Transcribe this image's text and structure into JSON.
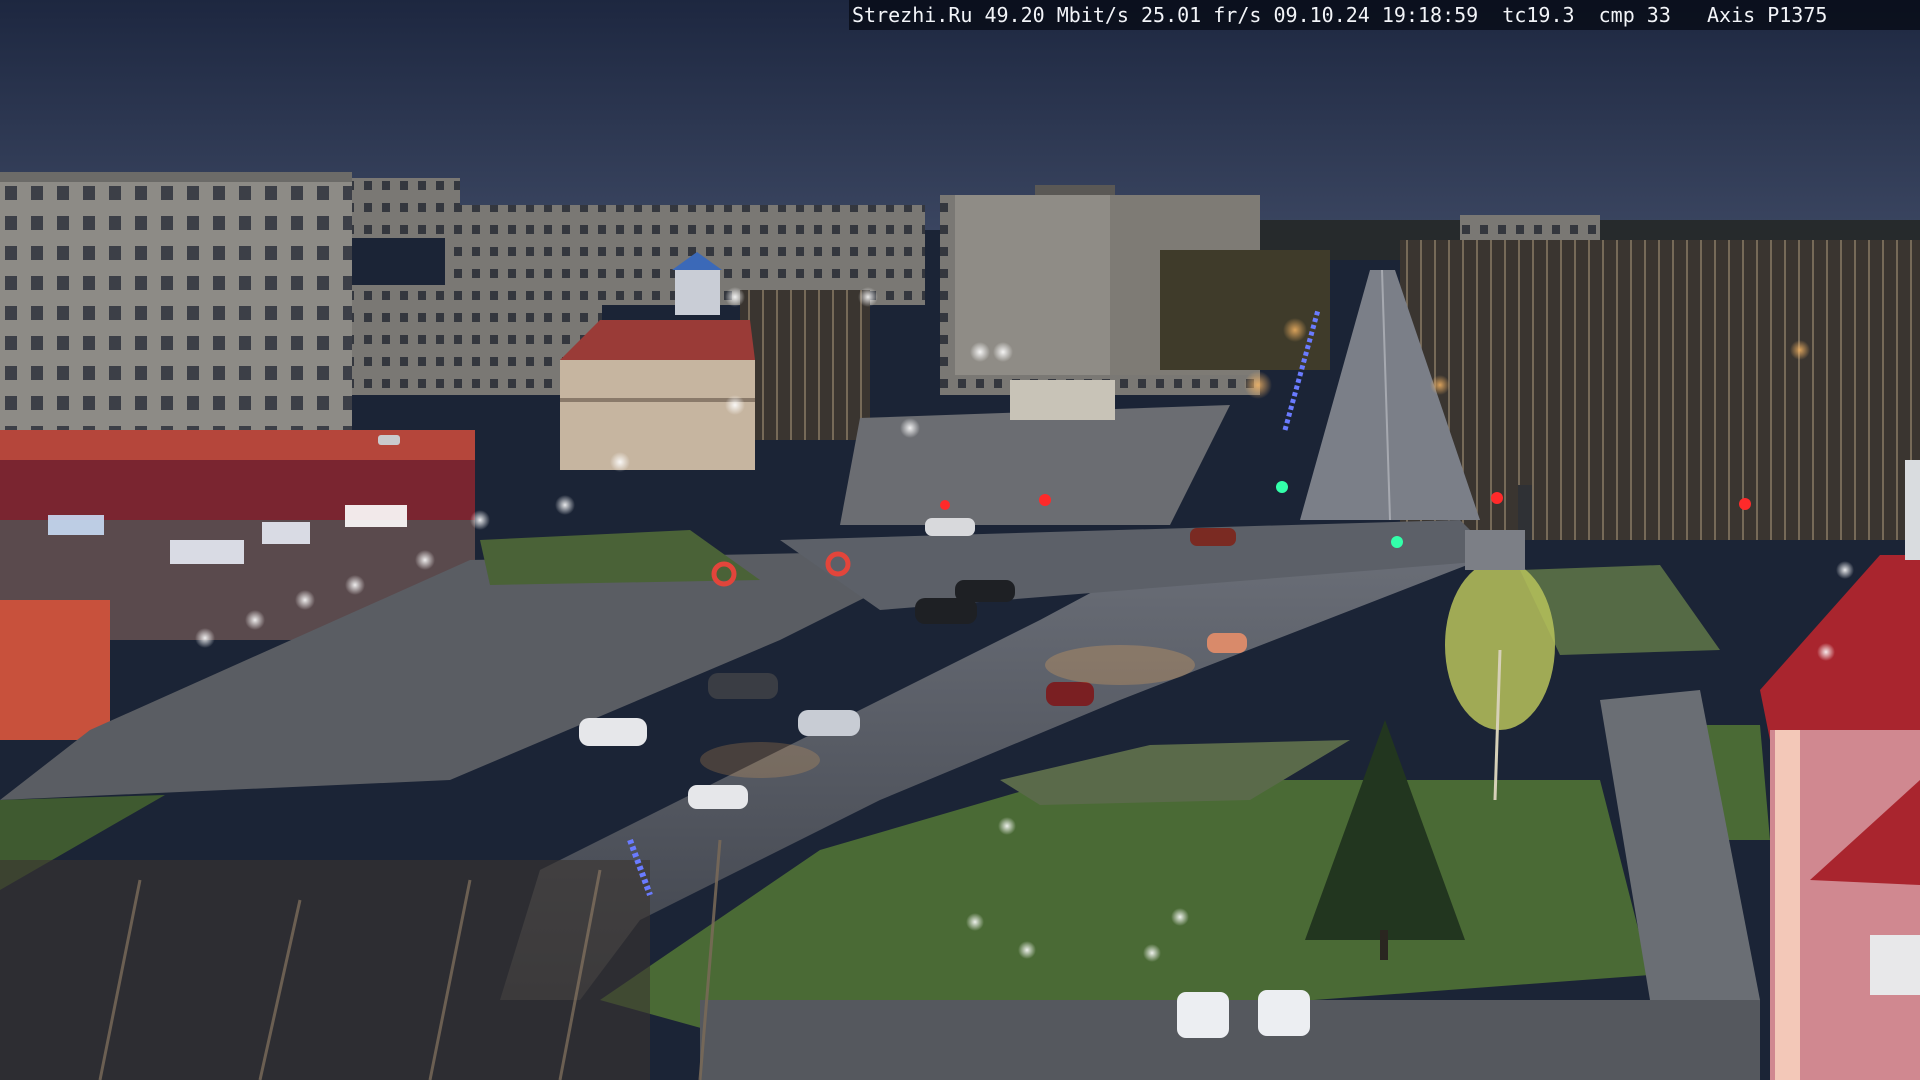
{
  "overlay": {
    "site": "Strezhi.Ru",
    "bitrate": "49.20 Mbit/s",
    "framerate": "25.01 fr/s",
    "date": "09.10.24",
    "time": "19:18:59",
    "tc": "tc19.3",
    "cmp": "cmp 33",
    "camera": "Axis P1375"
  },
  "storefront": {
    "sign_1": "",
    "sign_2": "",
    "sign_3": "",
    "sign_4": ""
  },
  "palette": {
    "sky_top": "#1c2740",
    "sky_horizon": "#37425a",
    "asphalt": "#4a4e57",
    "plaza": "#5f6369",
    "grass": "#4d6a3a",
    "facade_gray": "#8b8a86",
    "facade_red": "#b6443a",
    "window_lit": "#f2d98a",
    "lamp_white": "#f4f6ff",
    "lamp_orange": "#ffb35a",
    "signal_red": "#ff2a2a",
    "signal_green": "#33ffaa"
  }
}
